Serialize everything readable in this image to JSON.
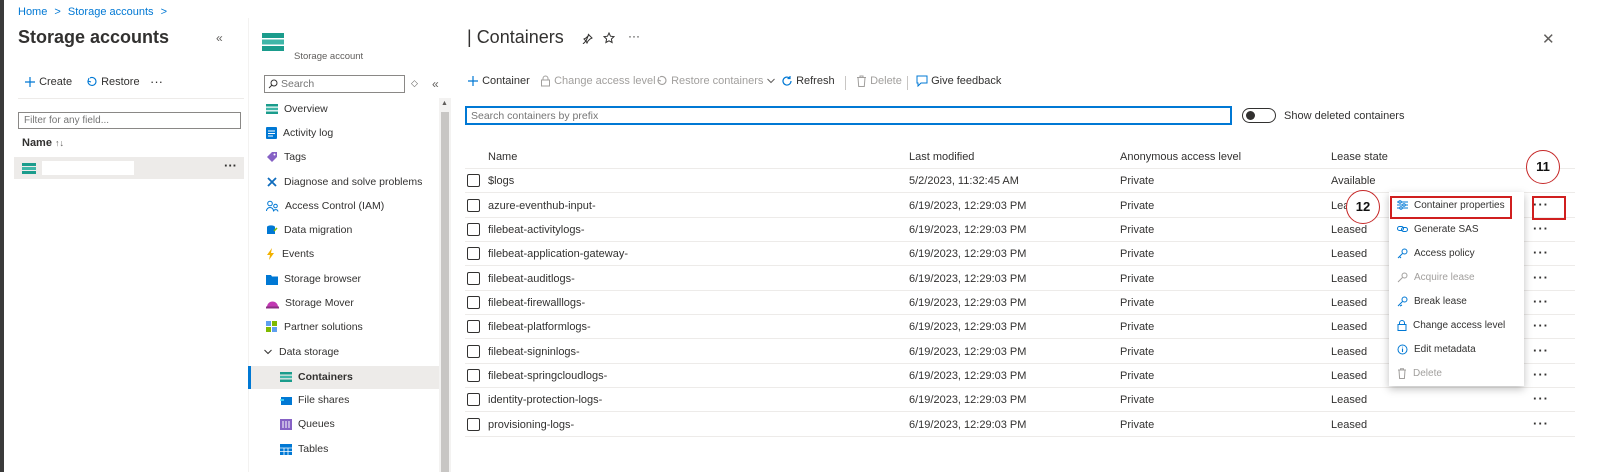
{
  "breadcrumb": {
    "home": "Home",
    "sep1": ">",
    "storage_accounts": "Storage accounts",
    "sep2": ">"
  },
  "left_pane": {
    "title": "Storage accounts",
    "collapse": "«",
    "create_label": "Create",
    "restore_label": "Restore",
    "more": "···",
    "filter_placeholder": "Filter for any field...",
    "name_header": "Name",
    "sort_glyph": "↑↓",
    "row_more": "···"
  },
  "resource_menu": {
    "subtitle": "Storage account",
    "search_placeholder": "Search",
    "collapse": "«",
    "small_glyph": "◇",
    "items": [
      {
        "label": "Overview"
      },
      {
        "label": "Activity log"
      },
      {
        "label": "Tags"
      },
      {
        "label": "Diagnose and solve problems"
      },
      {
        "label": "Access Control (IAM)"
      },
      {
        "label": "Data migration"
      },
      {
        "label": "Events"
      },
      {
        "label": "Storage browser"
      },
      {
        "label": "Storage Mover"
      },
      {
        "label": "Partner solutions"
      },
      {
        "label": "Data storage"
      },
      {
        "label": "Containers"
      },
      {
        "label": "File shares"
      },
      {
        "label": "Queues"
      },
      {
        "label": "Tables"
      }
    ]
  },
  "main": {
    "title": "Containers",
    "title_more": "···",
    "close": "✕",
    "toolbar": {
      "container": "Container",
      "change_access_level": "Change access level",
      "restore_containers": "Restore containers",
      "refresh": "Refresh",
      "delete": "Delete",
      "give_feedback": "Give feedback"
    },
    "search_placeholder": "Search containers by prefix",
    "show_deleted_label": "Show deleted containers",
    "columns": [
      "Name",
      "Last modified",
      "Anonymous access level",
      "Lease state"
    ],
    "rows": [
      {
        "name": "$logs",
        "modified": "5/2/2023, 11:32:45 AM",
        "access": "Private",
        "lease": "Available"
      },
      {
        "name": "azure-eventhub-input-",
        "modified": "6/19/2023, 12:29:03 PM",
        "access": "Private",
        "lease": "Leased"
      },
      {
        "name": "filebeat-activitylogs-",
        "modified": "6/19/2023, 12:29:03 PM",
        "access": "Private",
        "lease": "Leased"
      },
      {
        "name": "filebeat-application-gateway-",
        "modified": "6/19/2023, 12:29:03 PM",
        "access": "Private",
        "lease": "Leased"
      },
      {
        "name": "filebeat-auditlogs-",
        "modified": "6/19/2023, 12:29:03 PM",
        "access": "Private",
        "lease": "Leased"
      },
      {
        "name": "filebeat-firewalllogs-",
        "modified": "6/19/2023, 12:29:03 PM",
        "access": "Private",
        "lease": "Leased"
      },
      {
        "name": "filebeat-platformlogs-",
        "modified": "6/19/2023, 12:29:03 PM",
        "access": "Private",
        "lease": "Leased"
      },
      {
        "name": "filebeat-signinlogs-",
        "modified": "6/19/2023, 12:29:03 PM",
        "access": "Private",
        "lease": "Leased"
      },
      {
        "name": "filebeat-springcloudlogs-",
        "modified": "6/19/2023, 12:29:03 PM",
        "access": "Private",
        "lease": "Leased"
      },
      {
        "name": "identity-protection-logs-",
        "modified": "6/19/2023, 12:29:03 PM",
        "access": "Private",
        "lease": "Leased"
      },
      {
        "name": "provisioning-logs-",
        "modified": "6/19/2023, 12:29:03 PM",
        "access": "Private",
        "lease": "Leased"
      }
    ],
    "row_more": "···"
  },
  "context_menu": {
    "items": [
      {
        "label": "Container properties",
        "enabled": true
      },
      {
        "label": "Generate SAS",
        "enabled": true
      },
      {
        "label": "Access policy",
        "enabled": true
      },
      {
        "label": "Acquire lease",
        "enabled": false
      },
      {
        "label": "Break lease",
        "enabled": true
      },
      {
        "label": "Change access level",
        "enabled": true
      },
      {
        "label": "Edit metadata",
        "enabled": true
      },
      {
        "label": "Delete",
        "enabled": false
      }
    ]
  },
  "annotations": {
    "callout_11": "11",
    "callout_12": "12"
  },
  "colors": {
    "accent": "#0078d4",
    "highlight": "#d01f1f",
    "text": "#323130",
    "disabled": "#a19f9d"
  }
}
